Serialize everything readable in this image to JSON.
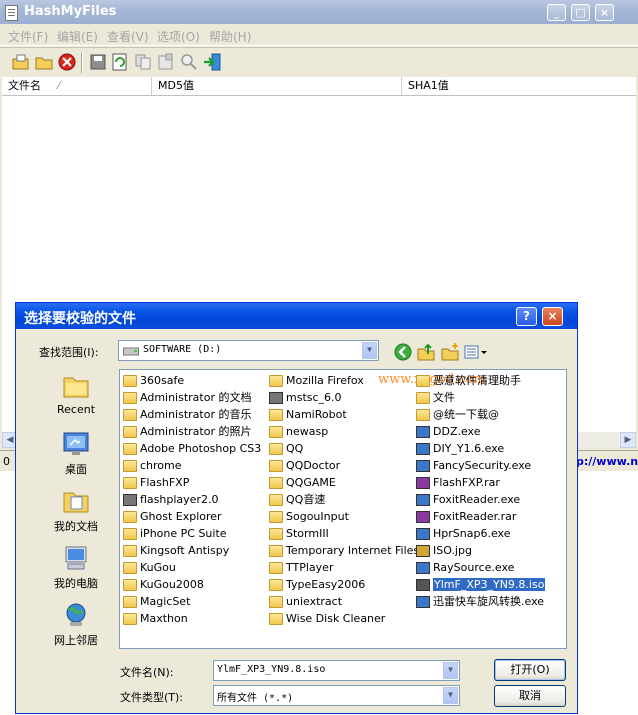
{
  "main": {
    "title": "HashMyFiles",
    "menu": [
      "文件(F)",
      "编辑(E)",
      "查看(V)",
      "选项(O)",
      "帮助(H)"
    ],
    "columns": [
      "文件名",
      "MD5值",
      "SHA1值"
    ],
    "status_left": "0",
    "status_right": "p://www.n"
  },
  "dialog": {
    "title": "选择要校验的文件",
    "look_in_label": "查找范围(I):",
    "look_in_value": "SOFTWARE (D:)",
    "places": [
      "Recent",
      "桌面",
      "我的文档",
      "我的电脑",
      "网上邻居"
    ],
    "watermark": "www.xpgod.com",
    "files_col1": [
      "360safe",
      "Administrator 的文档",
      "Administrator 的音乐",
      "Administrator 的照片",
      "Adobe Photoshop CS3",
      "chrome",
      "FlashFXP",
      "flashplayer2.0",
      "Ghost Explorer",
      "iPhone PC Suite",
      "Kingsoft Antispy",
      "KuGou",
      "KuGou2008",
      "MagicSet",
      "Maxthon"
    ],
    "files_col2": [
      "Mozilla Firefox",
      "mstsc_6.0",
      "NamiRobot",
      "newasp",
      "QQ",
      "QQDoctor",
      "QQGAME",
      "QQ音速",
      "SogouInput",
      "StormIII",
      "Temporary Internet Files",
      "TTPlayer",
      "TypeEasy2006",
      "uniextract",
      "Wise Disk Cleaner"
    ],
    "files_col3": [
      "恶意软件清理助手",
      "文件",
      "@统一下载@",
      "DDZ.exe",
      "DIY_Y1.6.exe",
      "FancySecurity.exe",
      "FlashFXP.rar",
      "FoxitReader.exe",
      "FoxitReader.rar",
      "HprSnap6.exe",
      "ISO.jpg",
      "RaySource.exe",
      "YlmF_XP3_YN9.8.iso",
      "迅雷快车旋风转换.exe"
    ],
    "selected_file": "YlmF_XP3_YN9.8.iso",
    "filename_label": "文件名(N):",
    "filename_value": "YlmF_XP3_YN9.8.iso",
    "filetype_label": "文件类型(T):",
    "filetype_value": "所有文件 (*.*)",
    "open_label": "打开(O)",
    "cancel_label": "取消"
  }
}
